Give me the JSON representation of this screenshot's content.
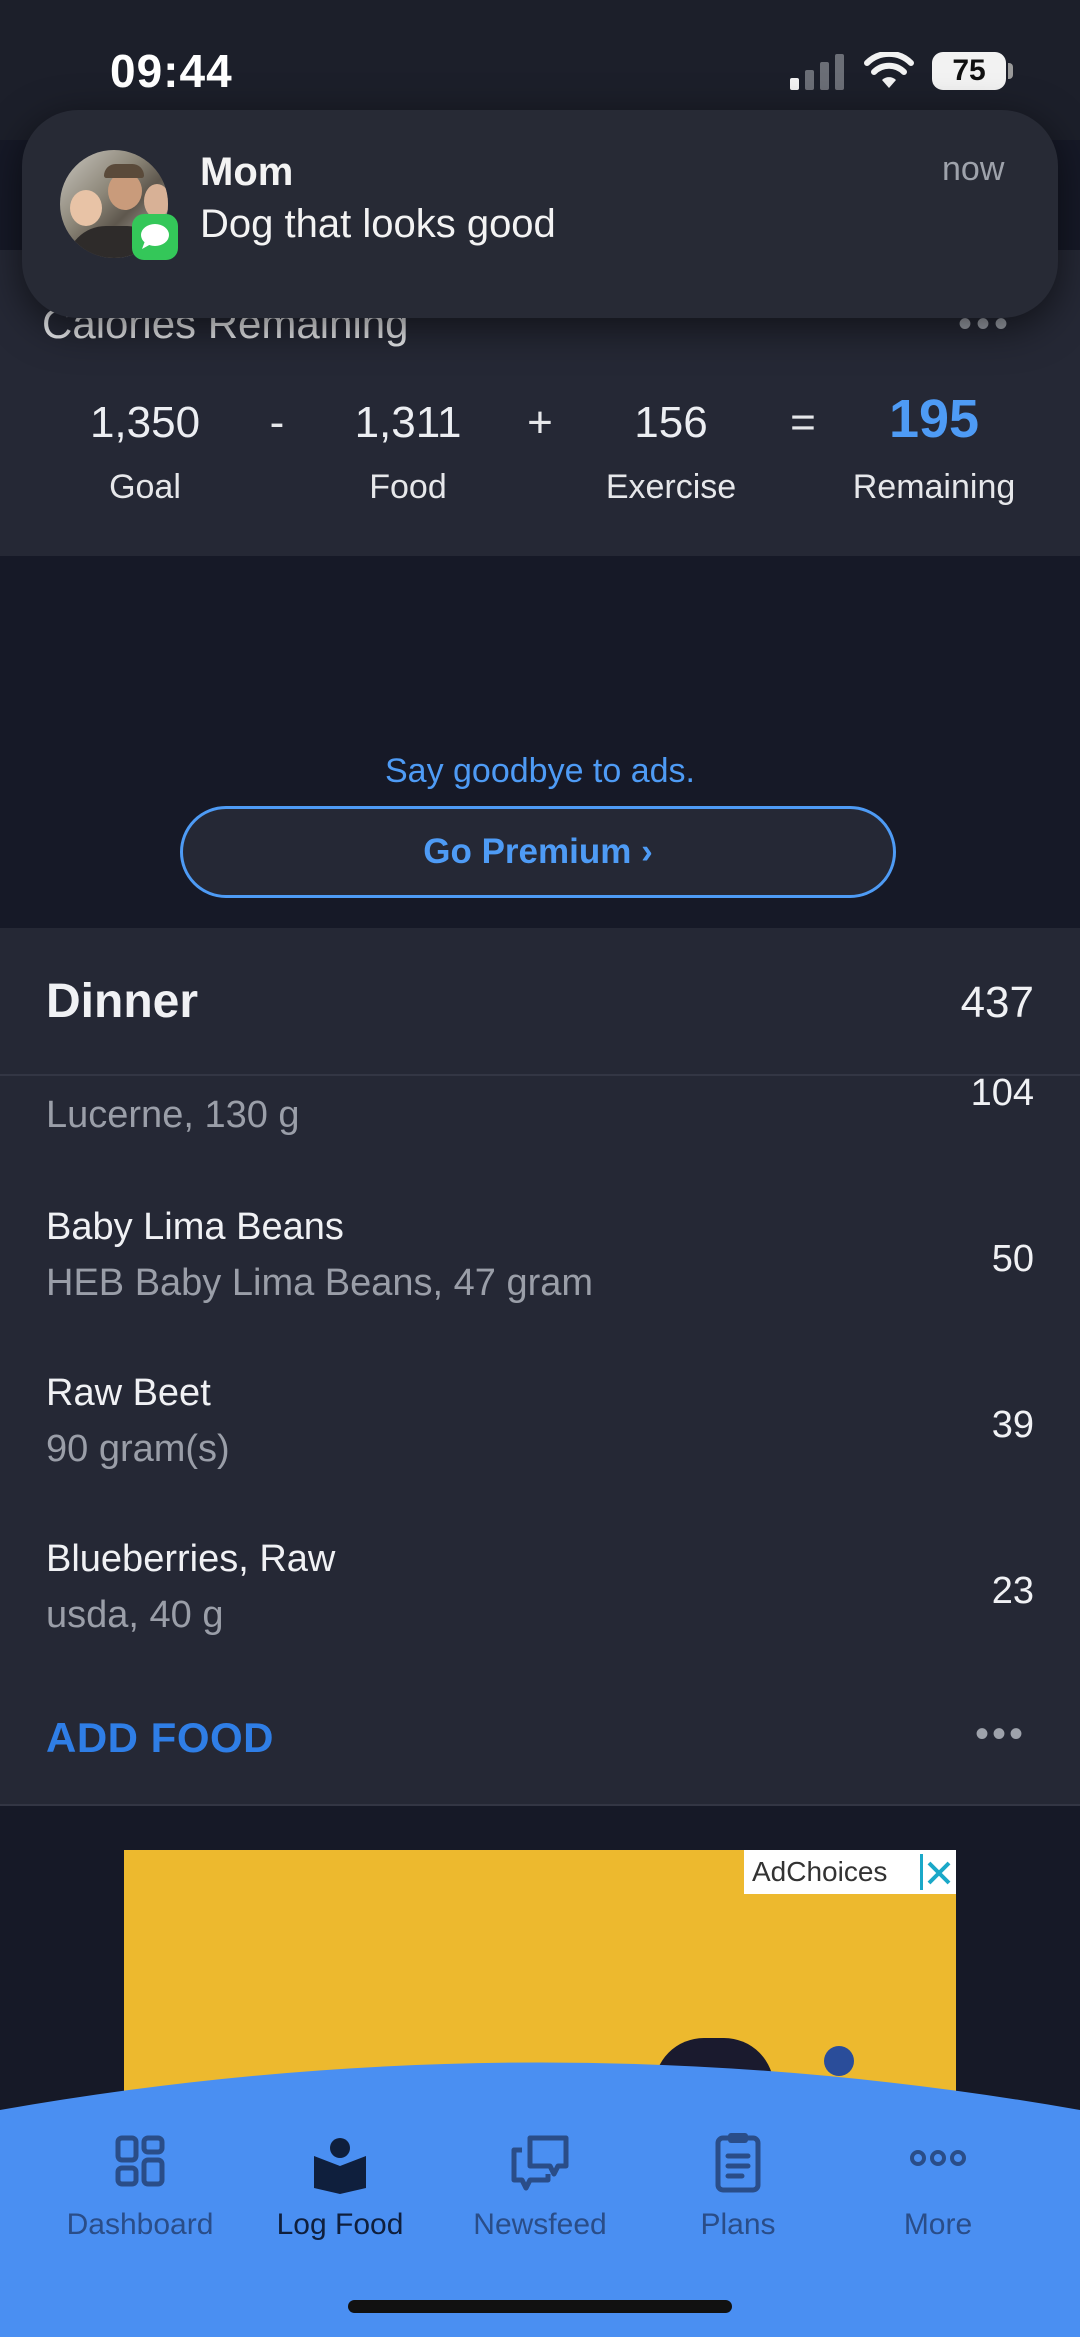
{
  "status_bar": {
    "time": "09:44",
    "battery": "75"
  },
  "notification": {
    "sender": "Mom",
    "message": "Dog that looks good",
    "time": "now"
  },
  "calories": {
    "title": "Calories Remaining",
    "goal_value": "1,350",
    "goal_label": "Goal",
    "food_value": "1,311",
    "food_label": "Food",
    "exercise_value": "156",
    "exercise_label": "Exercise",
    "remaining_value": "195",
    "remaining_label": "Remaining",
    "op_minus": "-",
    "op_plus": "+",
    "op_equals": "="
  },
  "promo": {
    "text": "Say goodbye to ads.",
    "button_label": "Go Premium ›"
  },
  "dinner": {
    "title": "Dinner",
    "total": "437",
    "items": [
      {
        "name": "",
        "description": "Lucerne, 130 g",
        "calories": "104"
      },
      {
        "name": "Baby Lima Beans",
        "description": "HEB Baby Lima Beans, 47 gram",
        "calories": "50"
      },
      {
        "name": "Raw Beet",
        "description": "90 gram(s)",
        "calories": "39"
      },
      {
        "name": "Blueberries, Raw",
        "description": "usda, 40 g",
        "calories": "23"
      }
    ],
    "add_food_label": "ADD FOOD"
  },
  "ad_banner": {
    "adchoices_label": "AdChoices"
  },
  "bottom_nav": {
    "items": [
      {
        "label": "Dashboard",
        "icon": "grid-icon"
      },
      {
        "label": "Log Food",
        "icon": "book-icon"
      },
      {
        "label": "Newsfeed",
        "icon": "chat-icon"
      },
      {
        "label": "Plans",
        "icon": "clipboard-icon"
      },
      {
        "label": "More",
        "icon": "more-icon"
      }
    ],
    "active": "Log Food"
  },
  "colors": {
    "accent": "#4e9bf5",
    "nav_bg": "#4a8ff2",
    "add_food": "#2f7ee6",
    "background": "#161927",
    "card": "#252835"
  }
}
